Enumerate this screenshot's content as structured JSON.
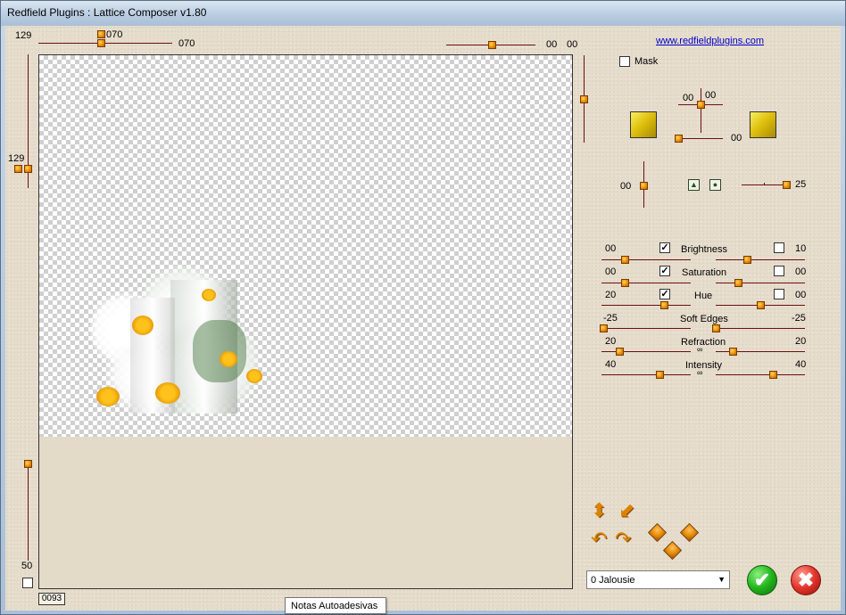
{
  "window": {
    "title": "Redfield Plugins : Lattice Composer v1.80"
  },
  "top_controls": {
    "corner_value": "129",
    "slider_a_value": "070",
    "slider_b_value": "070",
    "top_right_value_1": "00",
    "top_right_value_2": "00"
  },
  "left_controls": {
    "middle_value": "129",
    "bottom_value": "50",
    "frame_counter": "0093"
  },
  "right_panel": {
    "website_link": "www.redfieldplugins.com",
    "mask_label": "Mask",
    "mask_checked": false,
    "offset_x_value": "00",
    "offset_y_value": "00",
    "offset_slider_value": "00",
    "light_value": "00",
    "light_slider_value": "25",
    "color_swatch_1": "#e8cf1c",
    "color_swatch_2": "#e8cf1c",
    "adjustments": [
      {
        "left_value": "00",
        "label": "Brightness",
        "checked": true,
        "right_checked": false,
        "right_value": "10"
      },
      {
        "left_value": "00",
        "label": "Saturation",
        "checked": true,
        "right_checked": false,
        "right_value": "00"
      },
      {
        "left_value": "20",
        "label": "Hue",
        "checked": true,
        "right_checked": false,
        "right_value": "00"
      },
      {
        "left_value": "-25",
        "label": "Soft Edges",
        "right_value": "-25"
      },
      {
        "left_value": "20",
        "label": "Refraction",
        "right_value": "20"
      },
      {
        "left_value": "40",
        "label": "Intensity",
        "right_value": "40"
      }
    ]
  },
  "preset": {
    "selected": "0 Jalousie"
  },
  "buttons": {
    "ok_glyph": "✔",
    "cancel_glyph": "✖"
  },
  "tooltip": {
    "text": "Notas Autoadesivas"
  },
  "colors": {
    "panel_bg": "#e6dccb",
    "slider_track": "#6a1010",
    "knob_orange": "#f29b0c",
    "ok_green": "#24b51e",
    "cancel_red": "#e3352a",
    "link_blue": "#0000cc"
  }
}
